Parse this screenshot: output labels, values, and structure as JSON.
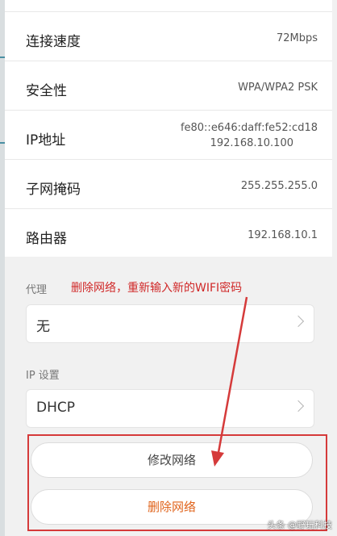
{
  "network_info": [
    {
      "label": "连接速度",
      "value": "72Mbps"
    },
    {
      "label": "安全性",
      "value": "WPA/WPA2 PSK"
    },
    {
      "label": "IP地址",
      "value_lines": [
        "fe80::e646:daff:fe52:cd18",
        "192.168.10.100"
      ]
    },
    {
      "label": "子网掩码",
      "value": "255.255.255.0"
    },
    {
      "label": "路由器",
      "value": "192.168.10.1"
    }
  ],
  "proxy": {
    "label": "代理",
    "value": "无"
  },
  "ip_settings": {
    "label": "IP 设置",
    "value": "DHCP"
  },
  "actions": {
    "modify_label": "修改网络",
    "delete_label": "删除网络"
  },
  "annotation": {
    "text": "删除网络，重新输入新的WIFI密码",
    "color": "#d02828"
  },
  "watermark": "头条 @野玩科技",
  "colors": {
    "delete_text": "#e0641c",
    "highlight_border": "#d53a3a"
  }
}
